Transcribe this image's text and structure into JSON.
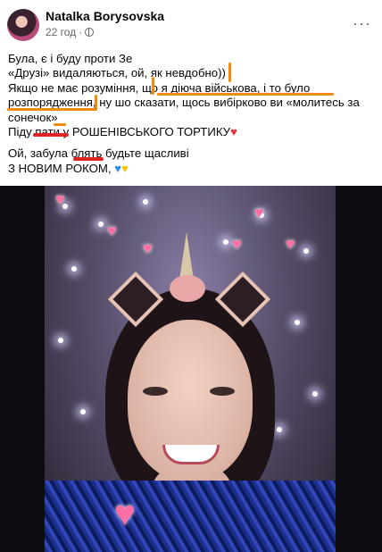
{
  "post": {
    "author": "Natalka Borysovska",
    "time": "22 год",
    "separator": "·",
    "more": "···",
    "lines": [
      "Була, є і буду проти Зе",
      "«Друзі» видаляються, ой, як невдобно))",
      "Якщо не має розуміння, що я діюча військова, і то було",
      "розпорядження, ну шо сказати, щось вибірково ви «молитесь за",
      "сонечок»",
      "Піду",
      "пати у",
      "РОШЕНІВСЬКОГО ТОРТИКУ",
      "Ой, забула",
      "блять",
      "будьте щасливі",
      "З НОВИМ РОКОМ,"
    ],
    "emoji": {
      "red_heart": "♥",
      "blue_heart": "♥",
      "yellow_heart": "♥"
    }
  },
  "colors": {
    "highlight": "#f08a12",
    "strike": "#e02424",
    "meta": "#65676b"
  }
}
